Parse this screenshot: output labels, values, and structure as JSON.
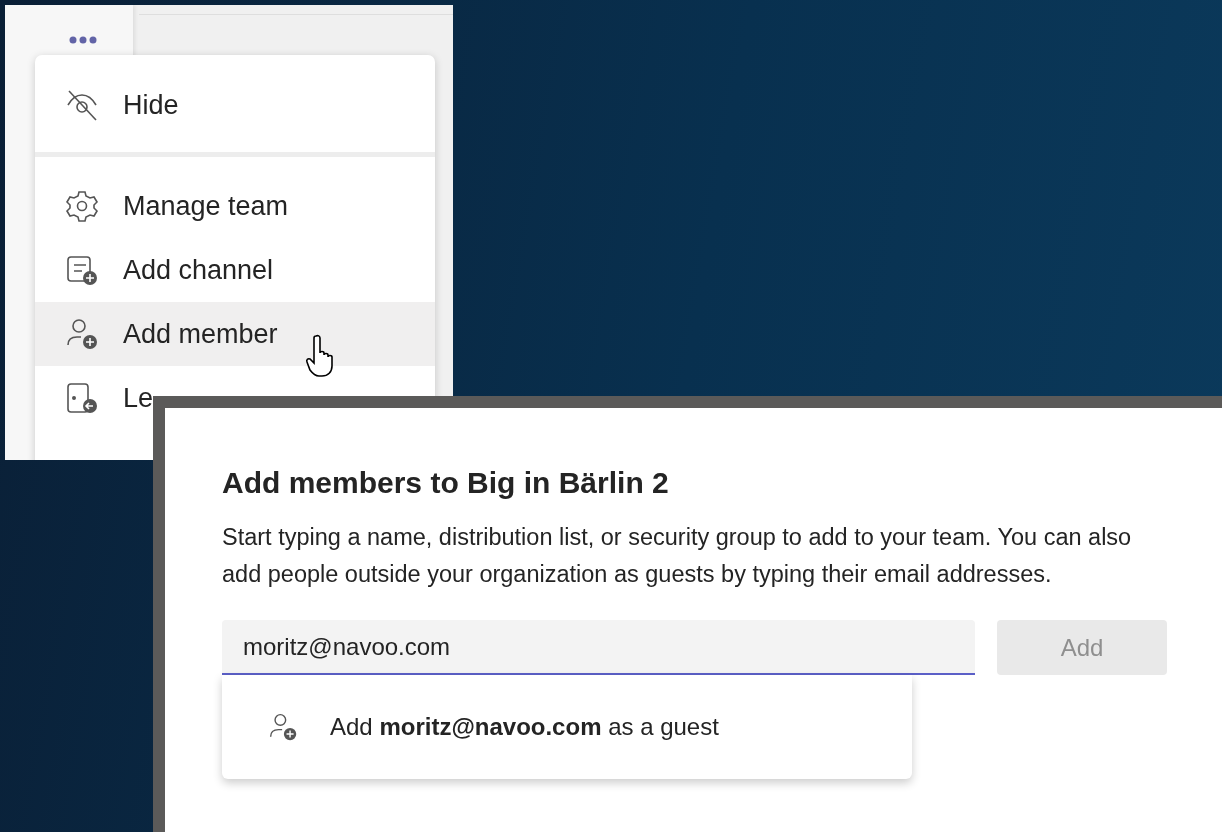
{
  "team_menu": {
    "groups": [
      [
        {
          "kind": "hide",
          "label": "Hide",
          "highlighted": false
        }
      ],
      [
        {
          "kind": "gear",
          "label": "Manage team",
          "highlighted": false
        },
        {
          "kind": "channel-add",
          "label": "Add channel",
          "highlighted": false
        },
        {
          "kind": "person-add",
          "label": "Add member",
          "highlighted": true
        },
        {
          "kind": "leave",
          "label": "Le",
          "highlighted": false
        }
      ]
    ]
  },
  "dialog": {
    "title": "Add members to Big in Bärlin 2",
    "description": "Start typing a name, distribution list, or security group to add to your team. You can also add people outside your organization as guests by typing their email addresses.",
    "input": {
      "value": "moritz@navoo.com"
    },
    "add_button": {
      "label": "Add",
      "disabled": true
    },
    "suggestion": {
      "text": "Add **moritz@navoo.com** as a guest"
    }
  }
}
